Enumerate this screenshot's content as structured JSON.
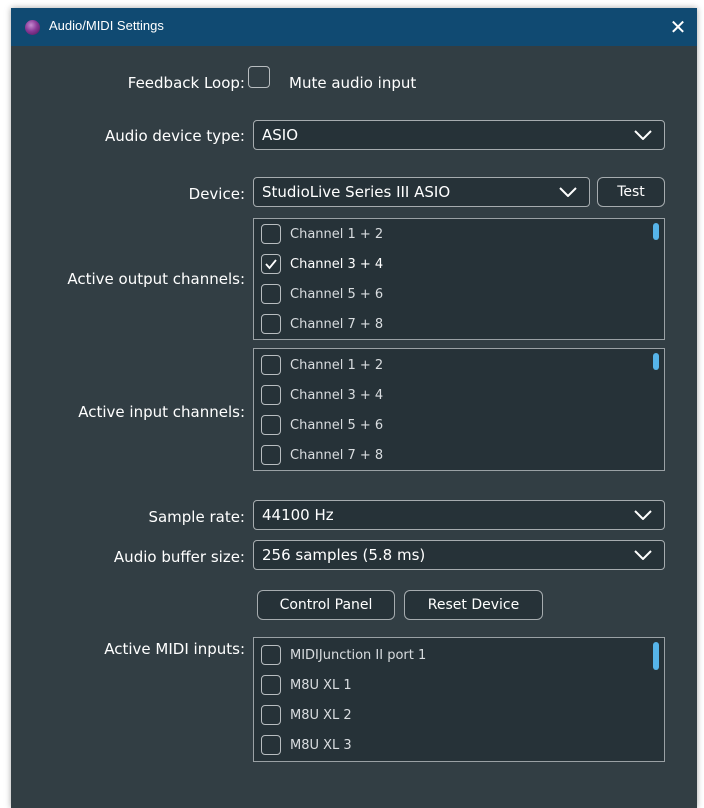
{
  "window": {
    "title": "Audio/MIDI Settings",
    "close_glyph": "✕"
  },
  "feedback": {
    "label": "Feedback Loop:",
    "checkbox_label": "Mute audio input",
    "checked": false
  },
  "device_type": {
    "label": "Audio device type:",
    "value": "ASIO"
  },
  "device": {
    "label": "Device:",
    "value": "StudioLive Series III ASIO",
    "test_label": "Test"
  },
  "output_channels": {
    "label": "Active output channels:",
    "items": [
      {
        "label": "Channel 1 + 2",
        "checked": false
      },
      {
        "label": "Channel 3 + 4",
        "checked": true
      },
      {
        "label": "Channel 5 + 6",
        "checked": false
      },
      {
        "label": "Channel 7 + 8",
        "checked": false
      }
    ]
  },
  "input_channels": {
    "label": "Active input channels:",
    "items": [
      {
        "label": "Channel 1 + 2",
        "checked": false
      },
      {
        "label": "Channel 3 + 4",
        "checked": false
      },
      {
        "label": "Channel 5 + 6",
        "checked": false
      },
      {
        "label": "Channel 7 + 8",
        "checked": false
      }
    ]
  },
  "sample_rate": {
    "label": "Sample rate:",
    "value": "44100 Hz"
  },
  "buffer_size": {
    "label": "Audio buffer size:",
    "value": "256 samples (5.8 ms)"
  },
  "buttons": {
    "control_panel": "Control Panel",
    "reset_device": "Reset Device"
  },
  "midi_inputs": {
    "label": "Active MIDI inputs:",
    "items": [
      {
        "label": "MIDIJunction II port 1",
        "checked": false
      },
      {
        "label": "M8U XL 1",
        "checked": false
      },
      {
        "label": "M8U XL 2",
        "checked": false
      },
      {
        "label": "M8U XL 3",
        "checked": false
      }
    ]
  },
  "colors": {
    "window_bg": "#323e44",
    "titlebar": "#104a72",
    "field_bg": "#263238",
    "accent": "#56b4e9"
  },
  "icons": {
    "app": "app-icon",
    "close": "close-icon",
    "dropdown": "chevron-down-icon",
    "check": "checkmark-icon"
  }
}
